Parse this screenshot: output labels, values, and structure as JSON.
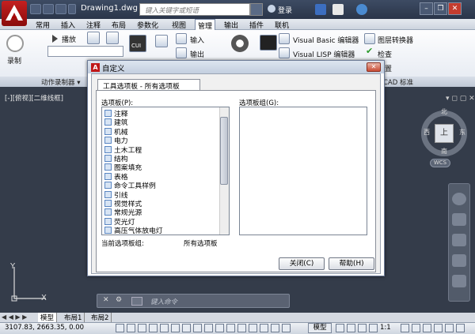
{
  "window": {
    "doc_title": "Drawing1.dwg",
    "search_placeholder": "键入关键字或短语",
    "login": "登录",
    "help": "?"
  },
  "menu": {
    "tabs": [
      "常用",
      "插入",
      "注释",
      "布局",
      "参数化",
      "视图",
      "管理",
      "输出",
      "插件",
      "联机"
    ],
    "active": "管理"
  },
  "ribbon": {
    "record": "录制",
    "play": "播放",
    "import": "输入",
    "export": "输出",
    "cui": "CUI",
    "vba": "Visual Basic 编辑器",
    "vlisp": "Visual LISP 编辑器",
    "layer_translator": "图层转换器",
    "check": "检查",
    "standards_btn": "配置",
    "panel_macro": "动作录制器 ▾",
    "panel_std": "CAD 标准"
  },
  "viewport": {
    "label": "[-][俯视][二维线框]",
    "controls": "▾ ◻ ▢ ✕"
  },
  "viewcube": {
    "top": "上",
    "north": "北",
    "south": "南",
    "east": "东",
    "west": "西",
    "wcs": "WCS"
  },
  "dialog": {
    "title": "自定义",
    "tab": "工具选项板 - 所有选项板",
    "palettes_label": "选项板(P):",
    "groups_label": "选项板组(G):",
    "palettes": [
      "注释",
      "建筑",
      "机械",
      "电力",
      "土木工程",
      "结构",
      "图案填充",
      "表格",
      "命令工具样例",
      "引线",
      "视觉样式",
      "常规光源",
      "荧光灯",
      "高压气体放电灯"
    ],
    "current_group_label": "当前选项板组:",
    "current_group_value": "所有选项板",
    "close_btn": "关闭(C)",
    "help_btn": "帮助(H)"
  },
  "command": {
    "prompt": "键入命令"
  },
  "layouts": {
    "tabs": [
      "模型",
      "布局1",
      "布局2"
    ],
    "active": "模型"
  },
  "status": {
    "coords": "3107.83, 2663.35, 0.00",
    "model": "模型",
    "scale": "1:1"
  },
  "axis": {
    "y": "Y",
    "x": "X"
  }
}
